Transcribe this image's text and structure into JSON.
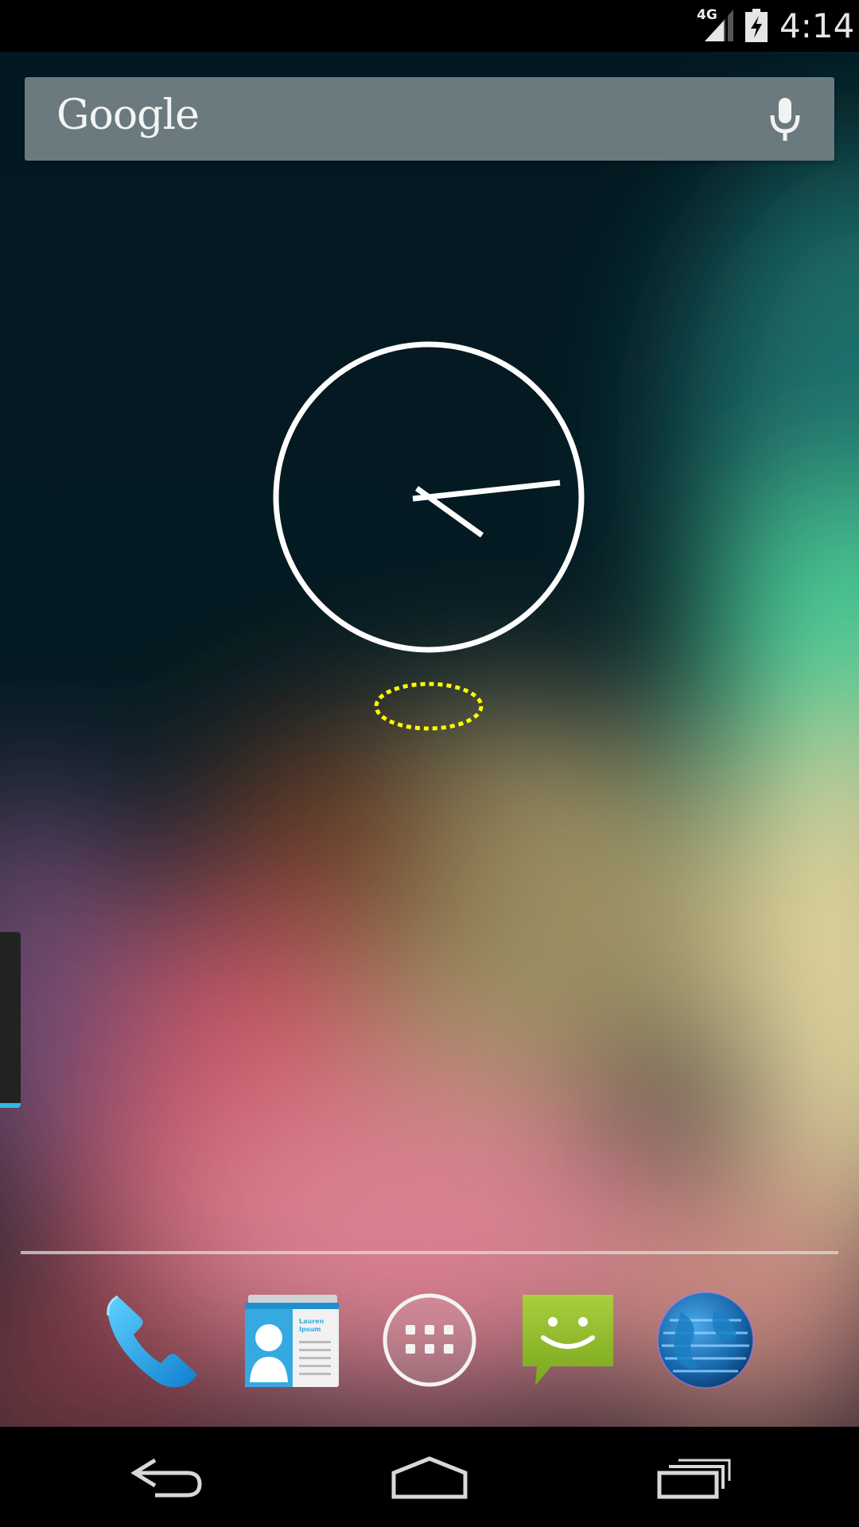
{
  "status_bar": {
    "network": "4G",
    "time": "4:14",
    "icons": [
      "signal-icon",
      "battery-charging-icon"
    ]
  },
  "search_widget": {
    "logo_text": "Google",
    "icons": [
      "mic-icon"
    ]
  },
  "clock_widget": {
    "type": "analog",
    "time_shown": "4:14"
  },
  "dock": {
    "items": [
      {
        "icon": "phone-icon"
      },
      {
        "icon": "contacts-icon",
        "card_text": "Lauren Ipsum"
      },
      {
        "icon": "all-apps-icon"
      },
      {
        "icon": "messaging-icon"
      },
      {
        "icon": "browser-globe-icon"
      }
    ]
  },
  "nav_bar": {
    "icons": [
      "back-icon",
      "home-icon",
      "recents-icon"
    ]
  },
  "colors": {
    "status_bar_bg": "#000000",
    "search_bar_bg": "#6a7a7f",
    "tap_indicator": "#ffff00",
    "accent_blue": "#33b5e5"
  }
}
